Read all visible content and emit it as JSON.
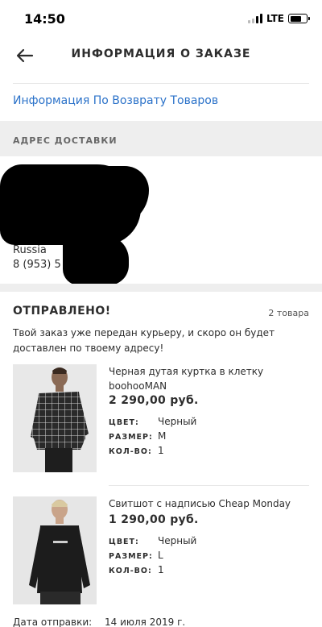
{
  "status_bar": {
    "time": "14:50",
    "network": "LTE"
  },
  "header": {
    "title": "ИНФОРМАЦИЯ О ЗАКАЗЕ"
  },
  "returns_link": "Информация По Возврату Товаров",
  "address": {
    "section_title": "АДРЕС ДОСТАВКИ",
    "country": "Russia",
    "phone": "8 (953) 5"
  },
  "shipment": {
    "status": "ОТПРАВЛЕНО!",
    "count": "2 товара",
    "description": "Твой заказ уже передан курьеру, и скоро он будет доставлен по твоему адресу!",
    "items": [
      {
        "name": "Черная дутая куртка в клетку boohooMAN",
        "price": "2 290,00 руб.",
        "color_label": "ЦВЕТ:",
        "color": "Черный",
        "size_label": "РАЗМЕР:",
        "size": "M",
        "qty_label": "КОЛ-ВО:",
        "qty": "1"
      },
      {
        "name": "Свитшот с надписью Cheap Monday",
        "price": "1 290,00 руб.",
        "color_label": "ЦВЕТ:",
        "color": "Черный",
        "size_label": "РАЗМЕР:",
        "size": "L",
        "qty_label": "КОЛ-ВО:",
        "qty": "1"
      }
    ],
    "ship_date_label": "Дата отправки:",
    "ship_date": "14 июля 2019 г."
  }
}
